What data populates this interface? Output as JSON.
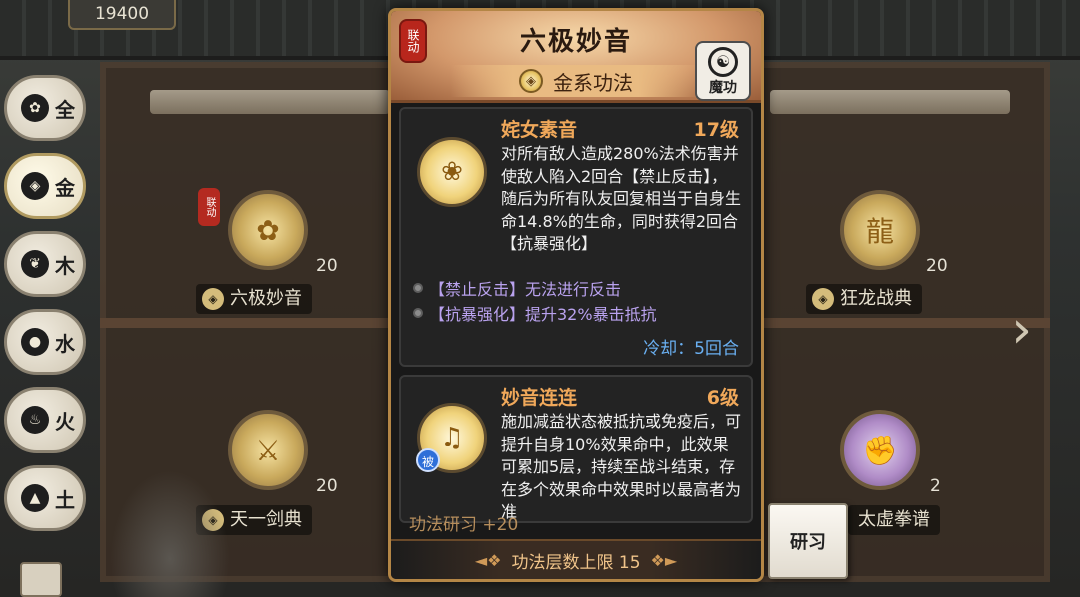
{
  "score": "19400",
  "sidebar": {
    "items": [
      {
        "label": "全",
        "icon": "✿"
      },
      {
        "label": "金",
        "icon": "◈"
      },
      {
        "label": "木",
        "icon": "❦"
      },
      {
        "label": "水",
        "icon": "●"
      },
      {
        "label": "火",
        "icon": "♨"
      },
      {
        "label": "土",
        "icon": "▲"
      }
    ]
  },
  "background_cards": [
    {
      "name": "六极妙音",
      "level": "20"
    },
    {
      "name": "狂龙战典",
      "level": "20"
    },
    {
      "name": "天一剑典",
      "level": "20"
    },
    {
      "name": "太虚拳谱",
      "level": "2"
    }
  ],
  "linked_badge": "联动",
  "panel": {
    "title": "六极妙音",
    "school": "金系功法",
    "category_badge": "魔功",
    "skills": [
      {
        "name": "姹女素音",
        "level": "17级",
        "description": "对所有敌人造成280%法术伤害并使敌人陷入2回合【禁止反击】，随后为所有队友回复相当于自身生命14.8%的生命，同时获得2回合【抗暴强化】",
        "effects": [
          "【禁止反击】无法进行反击",
          "【抗暴强化】提升32%暴击抵抗"
        ],
        "cooldown": "冷却：5回合"
      },
      {
        "name": "妙音连连",
        "level": "6级",
        "passive_label": "被",
        "description": "施加减益状态被抵抗或免疫后，可提升自身10%效果命中，此效果可累加5层，持续至战斗结束，存在多个效果命中效果时以最高者为准"
      }
    ],
    "research_partial": "功法研习 +20",
    "footer": "功法层数上限 15"
  },
  "research_button": "研习"
}
